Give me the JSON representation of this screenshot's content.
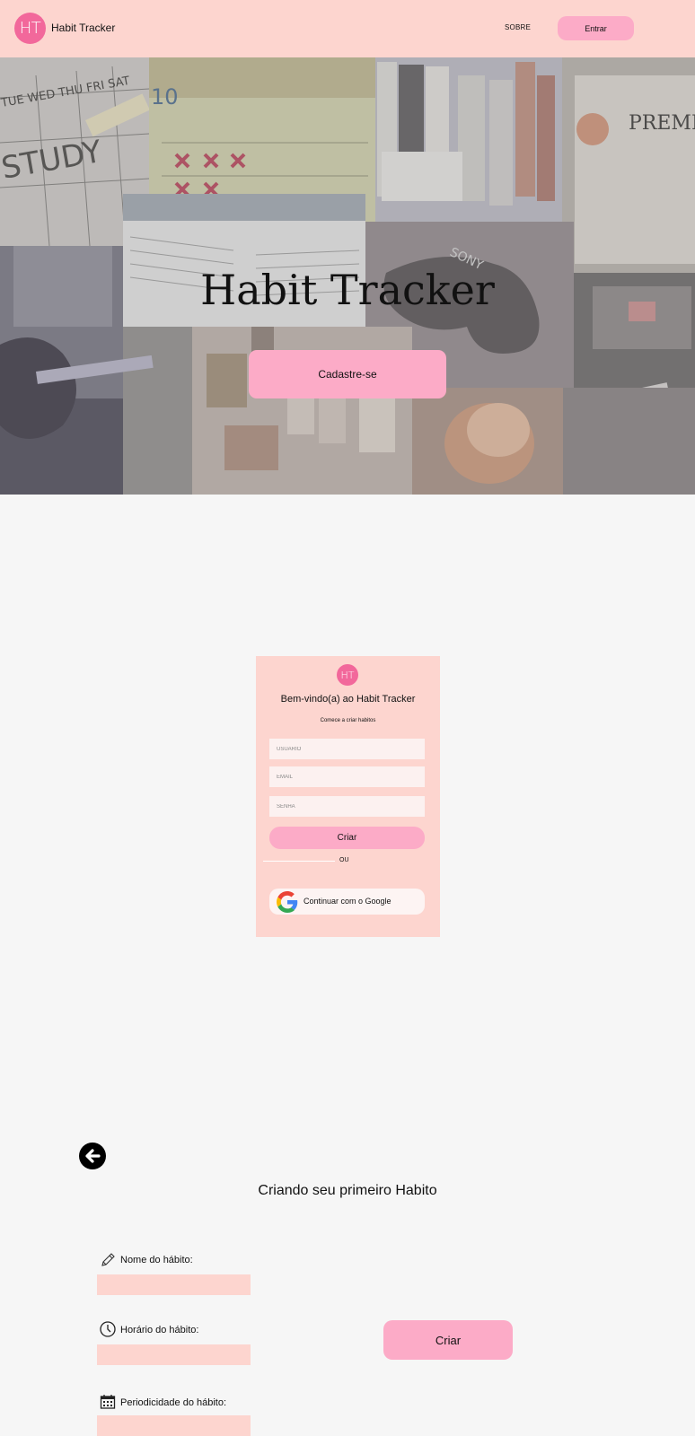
{
  "header": {
    "logo_text": "HT",
    "brand": "Habit Tracker",
    "nav_sobre": "SOBRE",
    "entrar_label": "Entrar"
  },
  "hero": {
    "title": "Habit Tracker",
    "cadastre_label": "Cadastre-se",
    "collage_labels": {
      "study": "STUDY",
      "calendar_number": "10",
      "premium": "PREMIUM",
      "sony": "SONY"
    }
  },
  "signup": {
    "logo_text": "HT",
    "title": "Bem-vindo(a) ao Habit Tracker",
    "subtitle": "Comece a criar habitos",
    "usuario_placeholder": "USUARIO",
    "email_placeholder": "EMAIL",
    "senha_placeholder": "SENHA",
    "criar_label": "Criar",
    "ou_label": "OU",
    "google_label": "Continuar com o Google"
  },
  "habit_form": {
    "title": "Criando seu primeiro Habito",
    "nome_label": "Nome do hábito:",
    "horario_label": "Horário do hábito:",
    "periodicidade_label": "Periodicidade do hábito:",
    "criar_label": "Criar"
  },
  "colors": {
    "header_bg": "#fdd5cf",
    "accent_pink": "#fcabc7",
    "logo_pink": "#f2689b",
    "page_bg": "#f6f6f6"
  }
}
